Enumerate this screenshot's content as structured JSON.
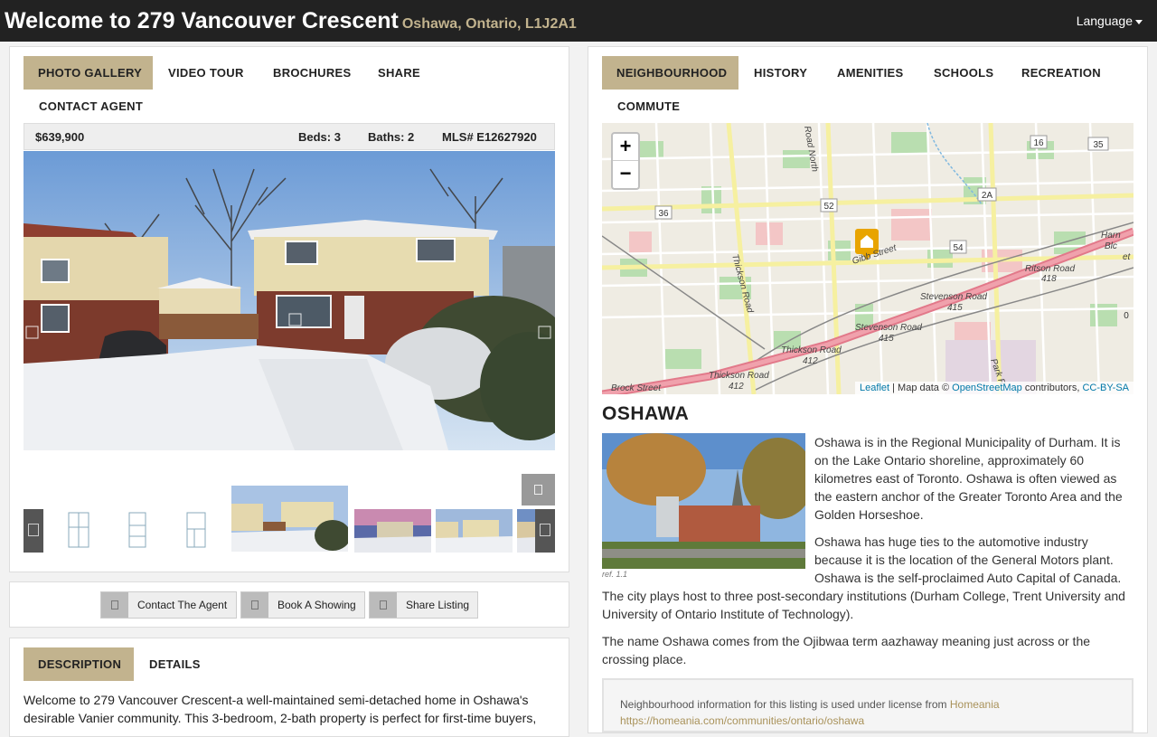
{
  "header": {
    "title": "Welcome to 279 Vancouver Crescent",
    "subtitle": "Oshawa, Ontario, L1J2A1",
    "language_label": "Language"
  },
  "left_tabs": [
    "PHOTO GALLERY",
    "VIDEO TOUR",
    "BROCHURES",
    "SHARE",
    "CONTACT AGENT"
  ],
  "listing": {
    "price": "$639,900",
    "beds": "Beds: 3",
    "baths": "Baths: 2",
    "mls": "MLS# E12627920"
  },
  "actions": {
    "contact": "Contact The Agent",
    "showing": "Book A Showing",
    "share": "Share Listing"
  },
  "desc_tabs": [
    "DESCRIPTION",
    "DETAILS"
  ],
  "description_text": "Welcome to 279 Vancouver Crescent-a well-maintained semi-detached home in Oshawa's desirable Vanier community. This 3-bedroom, 2-bath property is perfect for first-time buyers,",
  "right_tabs": [
    "NEIGHBOURHOOD",
    "HISTORY",
    "AMENITIES",
    "SCHOOLS",
    "RECREATION",
    "COMMUTE"
  ],
  "map": {
    "zoom_in": "+",
    "zoom_out": "−",
    "attribution_leaflet": "Leaflet",
    "attribution_mid": " | Map data © ",
    "attribution_osm": "OpenStreetMap",
    "attribution_contrib": " contributors, ",
    "attribution_cc": "CC-BY-SA",
    "labels": [
      "16",
      "35",
      "2A",
      "52",
      "36",
      "54",
      "Gibb Street",
      "Ritson Road",
      "418",
      "Stevenson Road",
      "415",
      "Stevenson Road",
      "415",
      "Thickson Road",
      "412",
      "Thickson Road",
      "412",
      "Thickson Road",
      "Brock Street",
      "Harn",
      "Blc",
      "Park R",
      "Road North",
      "0",
      "et"
    ]
  },
  "city": {
    "title": "OSHAWA",
    "ref": "ref. 1.1",
    "p1": "Oshawa is in the Regional Municipality of Durham. It is on the Lake Ontario shoreline, approximately 60 kilometres east of Toronto. Oshawa is often viewed as the eastern anchor of the Greater Toronto Area and the Golden Horseshoe.",
    "p2": "Oshawa has huge ties to the automotive industry because it is the location of the General Motors plant. Oshawa is the self-proclaimed Auto Capital of Canada. The city plays host to three post-secondary institutions (Durham College, Trent University and University of Ontario Institute of Technology).",
    "p3": "The name Oshawa comes from the Ojibwaa term aazhaway meaning just across or the crossing place."
  },
  "license": {
    "text": "Neighbourhood information for this listing is used under license from ",
    "link": "Homeania",
    "url": "https://homeania.com/communities/ontario/oshawa"
  }
}
